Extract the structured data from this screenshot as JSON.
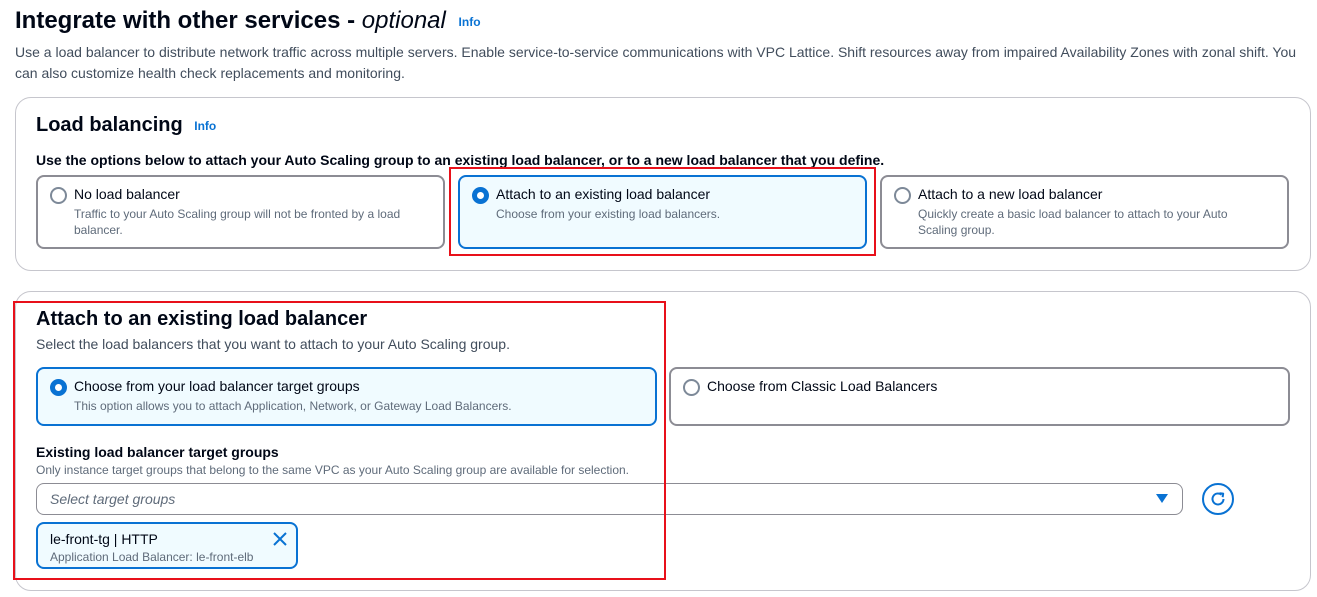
{
  "section": {
    "title": "Integrate with other services - ",
    "title_optional": "optional",
    "info": "Info",
    "description": "Use a load balancer to distribute network traffic across multiple servers. Enable service-to-service communications with VPC Lattice. Shift resources away from impaired Availability Zones with zonal shift. You can also customize health check replacements and monitoring."
  },
  "load_balancing": {
    "title": "Load balancing",
    "info": "Info",
    "instruction": "Use the options below to attach your Auto Scaling group to an existing load balancer, or to a new load balancer that you define.",
    "options": [
      {
        "label": "No load balancer",
        "description": "Traffic to your Auto Scaling group will not be fronted by a load balancer.",
        "selected": false
      },
      {
        "label": "Attach to an existing load balancer",
        "description": "Choose from your existing load balancers.",
        "selected": true
      },
      {
        "label": "Attach to a new load balancer",
        "description": "Quickly create a basic load balancer to attach to your Auto Scaling group.",
        "selected": false
      }
    ]
  },
  "attach_existing": {
    "title": "Attach to an existing load balancer",
    "description": "Select the load balancers that you want to attach to your Auto Scaling group.",
    "options": [
      {
        "label": "Choose from your load balancer target groups",
        "description": "This option allows you to attach Application, Network, or Gateway Load Balancers.",
        "selected": true
      },
      {
        "label": "Choose from Classic Load Balancers",
        "description": "",
        "selected": false
      }
    ],
    "target_groups": {
      "label": "Existing load balancer target groups",
      "description": "Only instance target groups that belong to the same VPC as your Auto Scaling group are available for selection.",
      "placeholder": "Select target groups",
      "selected": [
        {
          "name": "le-front-tg | HTTP",
          "detail": "Application Load Balancer: le-front-elb"
        }
      ]
    }
  },
  "colors": {
    "accent": "#0972d3",
    "highlight": "#e8101a",
    "selected_bg": "#f0fbff"
  },
  "icons": {
    "caret": "caret-down-icon",
    "refresh": "refresh-icon",
    "remove": "close-icon"
  }
}
